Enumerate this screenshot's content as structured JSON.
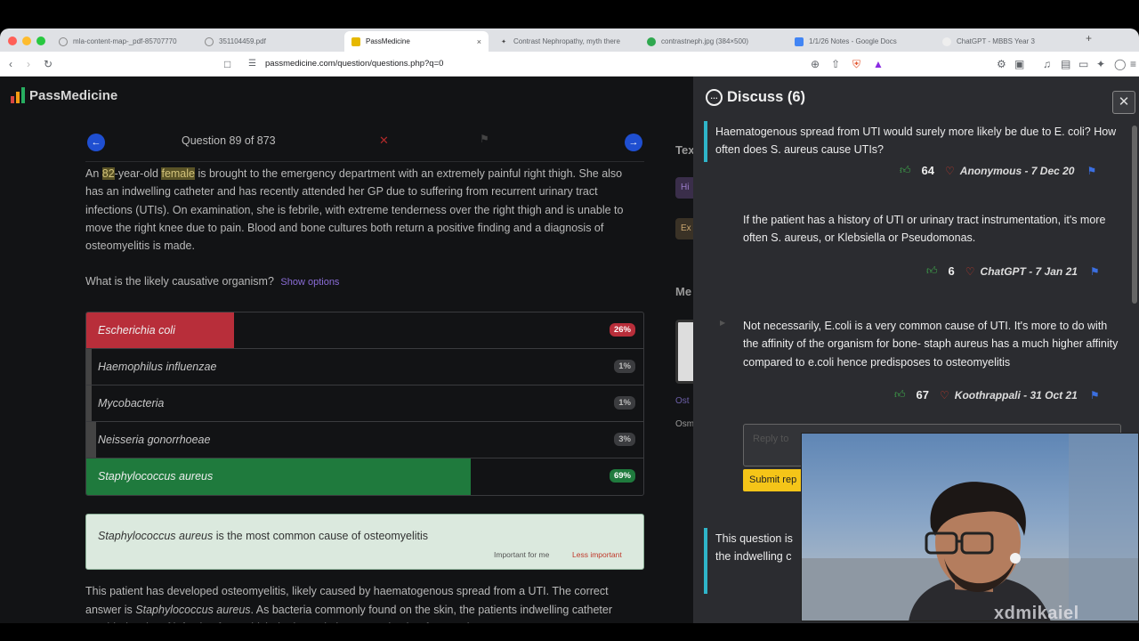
{
  "browser": {
    "tabs": [
      {
        "label": "mla-content-map-_pdf-85707770",
        "icon": "globe-icon",
        "color": "#8a8a8a"
      },
      {
        "label": "351104459.pdf",
        "icon": "globe-icon",
        "color": "#8a8a8a"
      },
      {
        "label": "PassMedicine",
        "icon": "passmedicine-icon",
        "color": "#e6b800",
        "active": true
      },
      {
        "label": "Contrast Nephropathy, myth there",
        "icon": "runner-icon",
        "color": "#444"
      },
      {
        "label": "contrastneph.jpg (384×500)",
        "icon": "image-icon",
        "color": "#2fa84f"
      },
      {
        "label": "1/1/26 Notes - Google Docs",
        "icon": "docs-icon",
        "color": "#4285f4"
      },
      {
        "label": "ChatGPT - MBBS Year 3",
        "icon": "chatgpt-icon",
        "color": "#ddd"
      }
    ],
    "new_tab": "+",
    "tab_close": "×",
    "url": "passmedicine.com/question/questions.php?q=0"
  },
  "logo": {
    "text": "PassMedicine",
    "bar_colors": [
      "#d64541",
      "#f39c12",
      "#27ae60"
    ]
  },
  "question": {
    "counter": "Question 89 of 873",
    "stem_parts": {
      "p1": "An ",
      "age": "82",
      "p2": "-year-old ",
      "sex": "female",
      "p3": " is brought to the emergency department with an extremely painful right thigh. She also has an indwelling catheter and has recently attended her GP due to suffering from recurrent urinary tract infections (UTIs). On examination, she is febrile, with extreme tenderness over the right thigh and is unable to move the right knee due to pain. Blood and bone cultures both return a positive finding and a diagnosis of osteomyelitis is made."
    },
    "prompt": "What is the likely causative organism?",
    "show_options": "Show options",
    "options": [
      {
        "label": "Escherichia coli",
        "percent_text": "26%",
        "percent": 26,
        "state": "wrong"
      },
      {
        "label": "Haemophilus influenzae",
        "percent_text": "1%",
        "percent": 1,
        "state": "neutral"
      },
      {
        "label": "Mycobacteria",
        "percent_text": "1%",
        "percent": 1,
        "state": "neutral"
      },
      {
        "label": "Neisseria gonorrhoeae",
        "percent_text": "3%",
        "percent": 3,
        "state": "neutral"
      },
      {
        "label": "Staphylococcus aureus",
        "percent_text": "69%",
        "percent": 69,
        "state": "correct"
      }
    ],
    "answer_box": {
      "organism": "Staphylococcus aureus",
      "rest": " is the most common cause of osteomyelitis",
      "important": "Important for me",
      "less_important": "Less important"
    },
    "explanation": {
      "p1": "This patient has developed osteomyelitis, likely caused by haematogenous spread from a UTI. The correct answer is ",
      "organism": "Staphylococcus aureus",
      "p2": ". As bacteria commonly found on the skin, the patients indwelling catheter provided a site of infection from which the bacteria has spread to her femur. Please"
    },
    "side_fragments": {
      "tex": "Tex",
      "me": "Me",
      "ost": "Ost",
      "osm": "Osm",
      "hi": "Hi",
      "ex": "Ex"
    }
  },
  "discuss": {
    "title": "Discuss (6)",
    "close": "✕",
    "comments": [
      {
        "text": "Haematogenous spread from UTI would surely more likely be due to E. coli? How often does S. aureus cause UTIs?",
        "votes": "64",
        "author": "Anonymous - 7 Dec 20"
      },
      {
        "text": "If the patient has a history of UTI or urinary tract instrumentation, it's more often S. aureus, or Klebsiella or Pseudomonas.",
        "votes": "6",
        "author": "ChatGPT - 7 Jan 21"
      },
      {
        "text": "Not necessarily, E.coli is a very common cause of UTI. It's more to do with the affinity of the organism for bone- staph aureus has a much higher affinity compared to e.coli hence predisposes to osteomyelitis",
        "votes": "67",
        "author": "Koothrappali - 31 Oct 21"
      },
      {
        "text": "This question is",
        "text2": "the indwelling c"
      }
    ],
    "reply_placeholder": "Reply to",
    "submit_label": "Submit rep"
  },
  "webcam": {
    "watermark": "xdmikaiel"
  }
}
